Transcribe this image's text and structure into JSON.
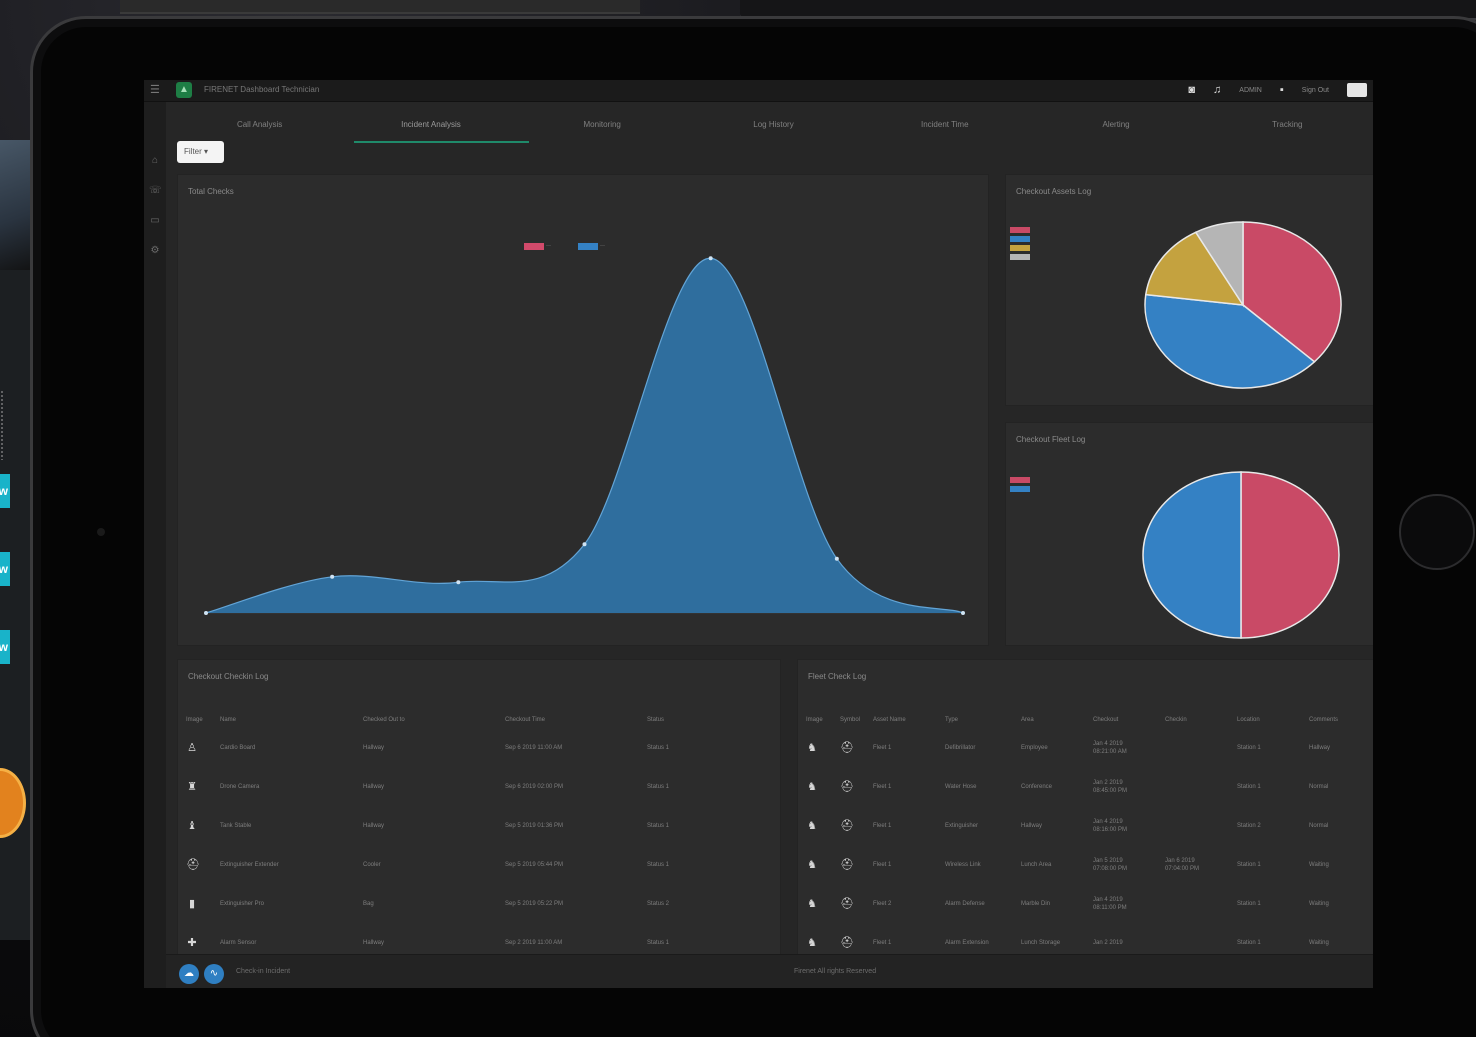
{
  "background": {
    "view_buttons": [
      "View",
      "View",
      "View"
    ]
  },
  "app": {
    "title": "FIRENET Dashboard Technician",
    "right_user": "ADMIN",
    "right_extra": "Sign Out"
  },
  "tabs": [
    {
      "label": "Call Analysis",
      "active": false
    },
    {
      "label": "Incident Analysis",
      "active": true
    },
    {
      "label": "Monitoring",
      "active": false
    },
    {
      "label": "Log History",
      "active": false
    },
    {
      "label": "Incident Time",
      "active": false
    },
    {
      "label": "Alerting",
      "active": false
    },
    {
      "label": "Tracking",
      "active": false
    }
  ],
  "filter": {
    "label": "Filter"
  },
  "area_chart": {
    "title": "Total Checks",
    "colors": {
      "fill": "#2f6e9e",
      "stroke": "#62a4d6",
      "accent": "#d24a6b"
    },
    "chart_data": {
      "type": "area",
      "x": [
        1,
        2,
        3,
        4,
        5,
        6,
        7
      ],
      "values": [
        0,
        1,
        0.85,
        1.9,
        9.8,
        1.5,
        0
      ],
      "ylim": [
        0,
        10
      ],
      "grid": false,
      "legend": "top-center"
    }
  },
  "pie_top": {
    "title": "Checkout Assets Log",
    "chart_data": {
      "type": "pie",
      "slices": [
        {
          "value": 37,
          "color": "#c94a66"
        },
        {
          "value": 40,
          "color": "#3481c4"
        },
        {
          "value": 15,
          "color": "#c4a23f"
        },
        {
          "value": 8,
          "color": "#b5b5b5"
        }
      ],
      "legend": "left"
    }
  },
  "pie_bottom": {
    "title": "Checkout Fleet Log",
    "chart_data": {
      "type": "pie",
      "slices": [
        {
          "value": 50,
          "color": "#c94a66"
        },
        {
          "value": 50,
          "color": "#3481c4"
        }
      ],
      "legend": "left"
    }
  },
  "table_left": {
    "title": "Checkout Checkin Log",
    "columns": [
      "Image",
      "Name",
      "Checked Out to",
      "Checkout Time",
      "Status"
    ],
    "rows": [
      {
        "icon": "person-icon",
        "cells": [
          "Cardio Board",
          "Hallway",
          "Sep 6 2019 11:00 AM",
          "Status 1"
        ]
      },
      {
        "icon": "hydrant-icon",
        "cells": [
          "Drone Camera",
          "Hallway",
          "Sep 6 2019 02:00 PM",
          "Status 1"
        ]
      },
      {
        "icon": "bottle-icon",
        "cells": [
          "Tank Stable",
          "Hallway",
          "Sep 5 2019 01:36 PM",
          "Status 1"
        ]
      },
      {
        "icon": "helmet-icon",
        "cells": [
          "Extinguisher Extender",
          "Cooler",
          "Sep 5 2019 05:44 PM",
          "Status 1"
        ]
      },
      {
        "icon": "cylinder-icon",
        "cells": [
          "Extinguisher Pro",
          "Bag",
          "Sep 5 2019 05:22 PM",
          "Status 2"
        ]
      },
      {
        "icon": "tool-icon",
        "cells": [
          "Alarm Sensor",
          "Hallway",
          "Sep 2 2019 11:00 AM",
          "Status 1"
        ]
      }
    ]
  },
  "table_right": {
    "title": "Fleet Check Log",
    "columns": [
      "Image",
      "Symbol",
      "Asset Name",
      "Type",
      "Area",
      "Checkout",
      "Checkin",
      "Location",
      "Comments"
    ],
    "rows": [
      {
        "cells": [
          "Fleet 1",
          "Defibrillator",
          "Employee",
          "Jan 4 2019\n08:21:00 AM",
          "",
          "Station 1",
          "Hallway"
        ]
      },
      {
        "cells": [
          "Fleet 1",
          "Water Hose",
          "Conference",
          "Jan 2 2019\n08:45:00 PM",
          "",
          "Station 1",
          "Normal"
        ]
      },
      {
        "cells": [
          "Fleet 1",
          "Extinguisher",
          "Hallway",
          "Jan 4 2019\n08:16:00 PM",
          "",
          "Station 2",
          "Normal"
        ]
      },
      {
        "cells": [
          "Fleet 1",
          "Wireless Link",
          "Lunch Area",
          "Jan 5 2019\n07:08:00 PM",
          "Jan 6 2019\n07:04:00 PM",
          "Station 1",
          "Waiting"
        ]
      },
      {
        "cells": [
          "Fleet 2",
          "Alarm Defense",
          "Marble Din",
          "Jan 4 2019\n08:11:00 PM",
          "",
          "Station 1",
          "Waiting"
        ]
      },
      {
        "cells": [
          "Fleet 1",
          "Alarm Extension",
          "Lunch Storage",
          "Jan 2 2019\n",
          "",
          "Station 1",
          "Waiting"
        ]
      }
    ]
  },
  "footer": {
    "left_text": "Check-in Incident",
    "center_text": "Firenet All rights Reserved"
  }
}
